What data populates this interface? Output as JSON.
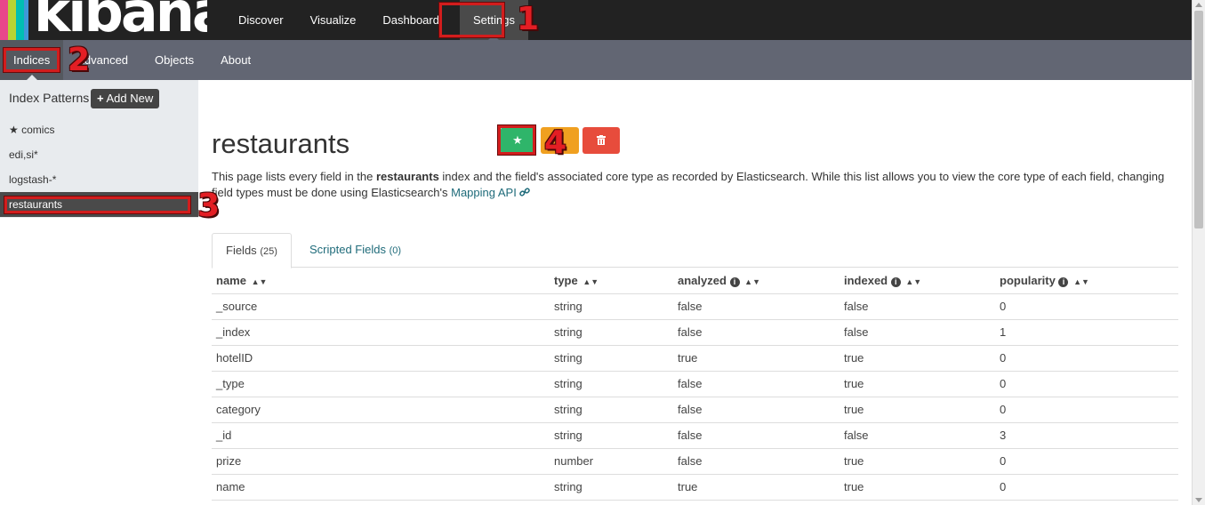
{
  "app": {
    "logo_text": "kibana",
    "logo_colors": [
      "#e8478b",
      "#b8d432",
      "#00bfb3",
      "#f0ab16",
      "#3f98d8"
    ]
  },
  "topnav": [
    {
      "label": "Discover"
    },
    {
      "label": "Visualize"
    },
    {
      "label": "Dashboard"
    },
    {
      "label": "Settings",
      "active": true
    }
  ],
  "subnav": [
    {
      "label": "Indices",
      "active": true
    },
    {
      "label": "Advanced"
    },
    {
      "label": "Objects"
    },
    {
      "label": "About"
    }
  ],
  "sidebar": {
    "header": "Index Patterns",
    "add_button": "Add New",
    "patterns": [
      {
        "label": "comics",
        "default": true
      },
      {
        "label": "edi,si*"
      },
      {
        "label": "logstash-*"
      },
      {
        "label": "restaurants",
        "active": true
      }
    ]
  },
  "main": {
    "title": "restaurants",
    "buttons": {
      "default_color": "#2fb56a",
      "refresh_color": "#f0a020",
      "delete_color": "#e74c3c"
    },
    "desc": {
      "pre": "This page lists every field in the ",
      "bold": "restaurants",
      "post": " index and the field's associated core type as recorded by Elasticsearch. While this list allows you to view the core type of each field, changing field types must be done using Elasticsearch's ",
      "link": "Mapping API"
    },
    "tabs": [
      {
        "label": "Fields",
        "count": "(25)",
        "active": true
      },
      {
        "label": "Scripted Fields",
        "count": "(0)"
      }
    ],
    "columns": [
      "name",
      "type",
      "analyzed",
      "indexed",
      "popularity"
    ],
    "rows": [
      [
        "_source",
        "string",
        "false",
        "false",
        "0"
      ],
      [
        "_index",
        "string",
        "false",
        "false",
        "1"
      ],
      [
        "hotelID",
        "string",
        "true",
        "true",
        "0"
      ],
      [
        "_type",
        "string",
        "false",
        "true",
        "0"
      ],
      [
        "category",
        "string",
        "false",
        "true",
        "0"
      ],
      [
        "_id",
        "string",
        "false",
        "false",
        "3"
      ],
      [
        "prize",
        "number",
        "false",
        "true",
        "0"
      ],
      [
        "name",
        "string",
        "true",
        "true",
        "0"
      ]
    ]
  },
  "annotations": [
    "1",
    "2",
    "3",
    "4"
  ],
  "colors": {
    "highlight": "#d21d1d",
    "link": "#1f6b7a"
  }
}
